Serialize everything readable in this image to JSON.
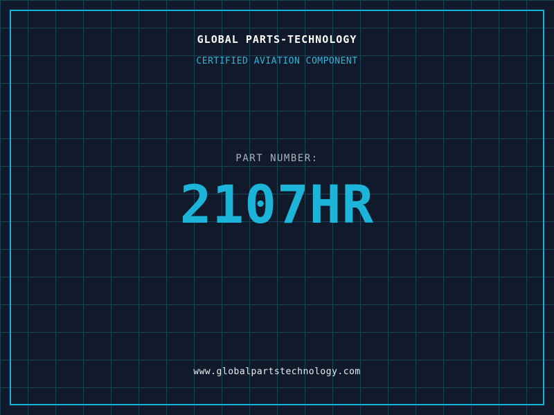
{
  "header": {
    "title": "GLOBAL PARTS-TECHNOLOGY",
    "subtitle": "CERTIFIED AVIATION COMPONENT"
  },
  "part": {
    "label": "PART NUMBER:",
    "number": "2107HR"
  },
  "footer": {
    "website": "www.globalpartstechnology.com"
  },
  "colors": {
    "background": "#101a2a",
    "grid_line": "#1a4356",
    "frame_border": "#0fb5da",
    "title_text": "#ffffff",
    "subtitle_text": "#2fb5d9",
    "part_label_text": "#a9b4bd",
    "part_number_text": "#1db4d9",
    "footer_text": "#e9eef0"
  }
}
